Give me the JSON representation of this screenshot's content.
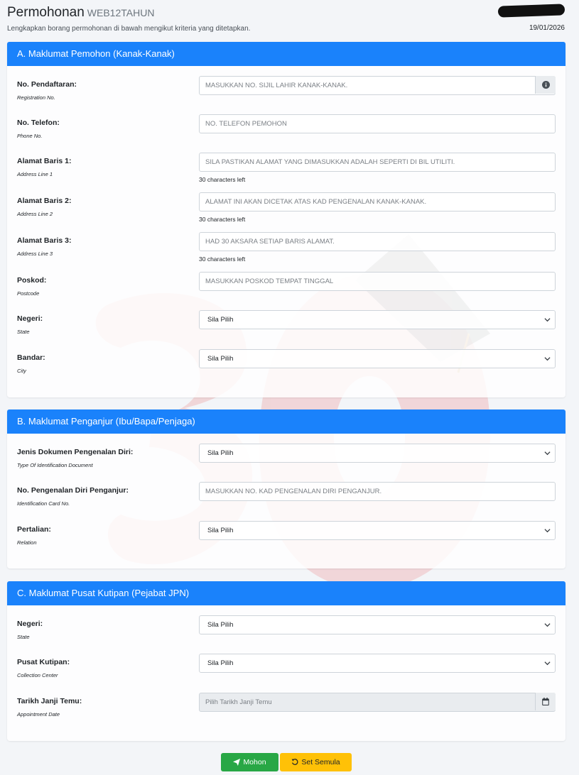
{
  "header": {
    "title": "Permohonan",
    "title_suffix": "WEB12TAHUN",
    "subtitle": "Lengkapkan borang permohonan di bawah mengikut kriteria yang ditetapkan.",
    "date": "19/01/2026"
  },
  "colors": {
    "primary": "#1a82fb",
    "success": "#28a745",
    "warning": "#ffc107"
  },
  "section_a": {
    "title": "A. Maklumat Pemohon (Kanak-Kanak)",
    "registration": {
      "label": "No. Pendaftaran:",
      "label_en": "Registration No.",
      "placeholder": "MASUKKAN NO. SIJIL LAHIR KANAK-KANAK.",
      "icon": "info-circle-icon"
    },
    "phone": {
      "label": "No. Telefon:",
      "label_en": "Phone No.",
      "placeholder": "NO. TELEFON PEMOHON"
    },
    "address1": {
      "label": "Alamat Baris 1:",
      "label_en": "Address Line 1",
      "placeholder": "SILA PASTIKAN ALAMAT YANG DIMASUKKAN ADALAH SEPERTI DI BIL UTILITI.",
      "help": "30 characters left"
    },
    "address2": {
      "label": "Alamat Baris 2:",
      "label_en": "Address Line 2",
      "placeholder": "ALAMAT INI AKAN DICETAK ATAS KAD PENGENALAN KANAK-KANAK.",
      "help": "30 characters left"
    },
    "address3": {
      "label": "Alamat Baris 3:",
      "label_en": "Address Line 3",
      "placeholder": "HAD 30 AKSARA SETIAP BARIS ALAMAT.",
      "help": "30 characters left"
    },
    "postcode": {
      "label": "Poskod:",
      "label_en": "Postcode",
      "placeholder": "MASUKKAN POSKOD TEMPAT TINGGAL"
    },
    "state": {
      "label": "Negeri:",
      "label_en": "State",
      "value": "Sila Pilih"
    },
    "city": {
      "label": "Bandar:",
      "label_en": "City",
      "value": "Sila Pilih"
    }
  },
  "section_b": {
    "title": "B. Maklumat Penganjur (Ibu/Bapa/Penjaga)",
    "doc_type": {
      "label": "Jenis Dokumen Pengenalan Diri:",
      "label_en": "Type Of Identification Document",
      "value": "Sila Pilih"
    },
    "id_no": {
      "label": "No. Pengenalan Diri Penganjur:",
      "label_en": "Identification Card No.",
      "placeholder": "MASUKKAN NO. KAD PENGENALAN DIRI PENGANJUR."
    },
    "relation": {
      "label": "Pertalian:",
      "label_en": "Relation",
      "value": "Sila Pilih"
    }
  },
  "section_c": {
    "title": "C. Maklumat Pusat Kutipan (Pejabat JPN)",
    "state": {
      "label": "Negeri:",
      "label_en": "State",
      "value": "Sila Pilih"
    },
    "center": {
      "label": "Pusat Kutipan:",
      "label_en": "Collection Center",
      "value": "Sila Pilih"
    },
    "appointment": {
      "label": "Tarikh Janji Temu:",
      "label_en": "Appointment Date",
      "placeholder": "Pilih Tarikh Janji Temu",
      "icon": "calendar-icon"
    }
  },
  "actions": {
    "submit": "Mohon",
    "reset": "Set Semula"
  },
  "watermark": {
    "text": "30"
  }
}
